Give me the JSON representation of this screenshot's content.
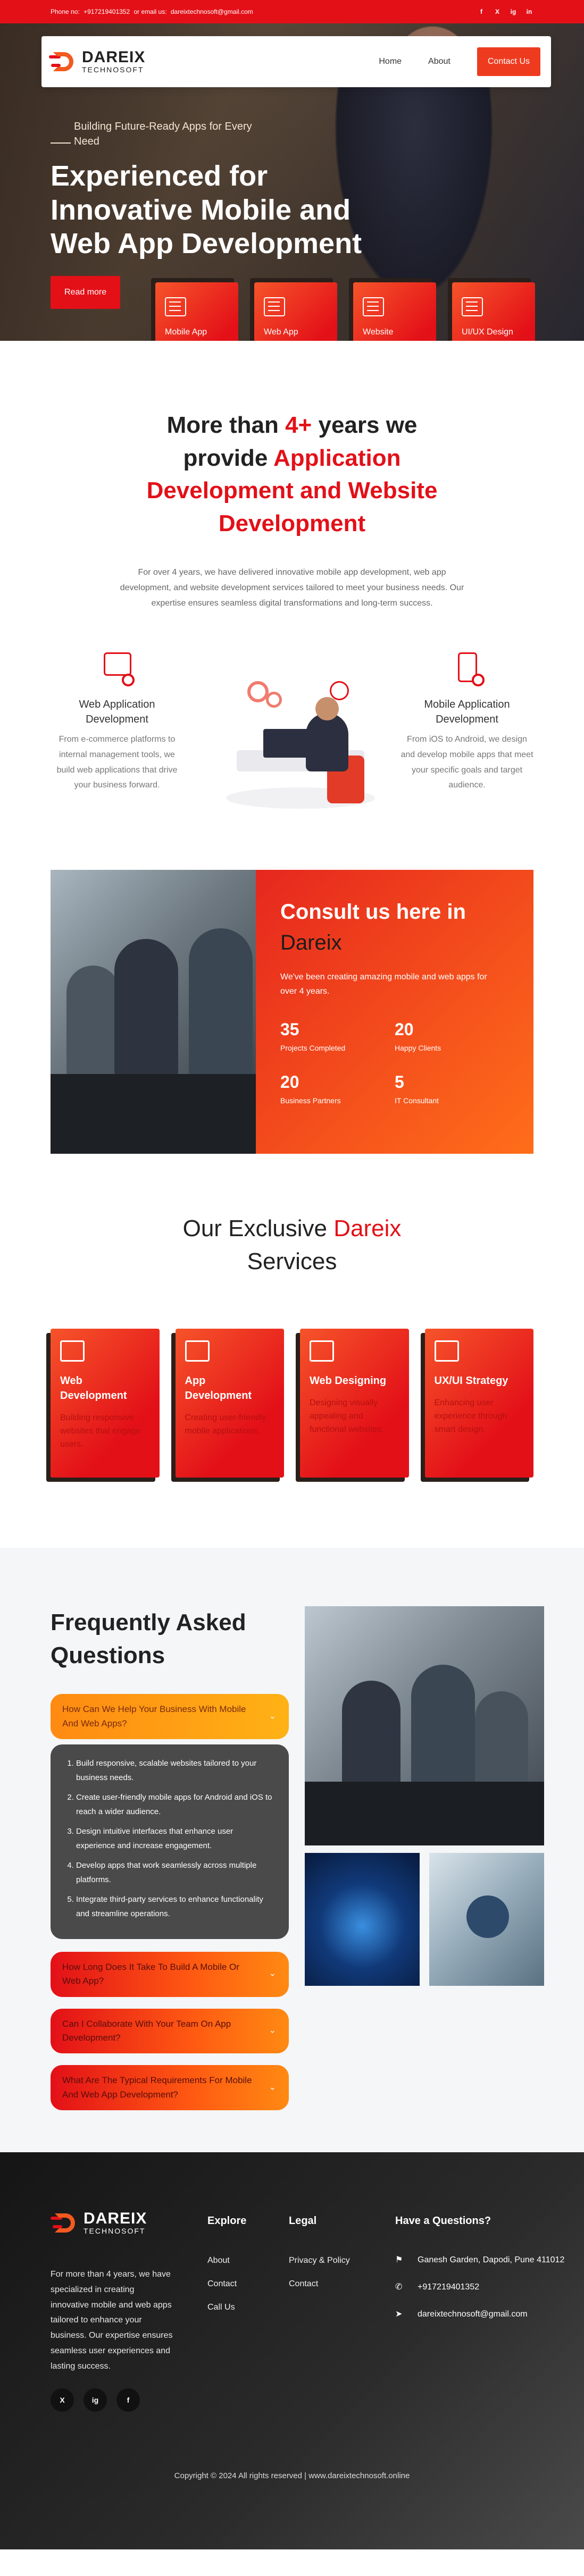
{
  "topbar": {
    "phone_label": "Phone no:",
    "phone": "+917219401352",
    "email_label": "or email us:",
    "email": "dareixtechnosoft@gmail.com",
    "socials": [
      "f",
      "X",
      "ig",
      "in"
    ]
  },
  "brand": {
    "name": "DAREIX",
    "sub": "TECHNOSOFT"
  },
  "nav": {
    "links": [
      "Home",
      "About"
    ],
    "cta": "Contact Us"
  },
  "hero": {
    "tagline": "Building Future-Ready Apps for Every Need",
    "title": "Experienced for Innovative Mobile and Web App Development",
    "button": "Read more",
    "cards": [
      "Mobile App Development",
      "Web App Development",
      "Website Development",
      "UI/UX Design"
    ]
  },
  "about": {
    "heading_1": "More than",
    "heading_highlight_1": "4+",
    "heading_2": "years we provide",
    "heading_highlight_2": "Application Development and Website Development",
    "lead": "For over 4 years, we have delivered innovative mobile app development, web app development, and website development services tailored to meet your business needs. Our expertise ensures seamless digital transformations and long-term success.",
    "features": [
      {
        "title": "Web Application Development",
        "text": "From e-commerce platforms to internal management tools, we build web applications that drive your business forward."
      },
      {
        "title": "Mobile Application Development",
        "text": "From iOS to Android, we design and develop mobile apps that meet your specific goals and target audience."
      }
    ]
  },
  "consult": {
    "title": "Consult us here in",
    "title_dark": "Dareix",
    "desc": "We've been creating amazing mobile and web apps for over 4 years.",
    "stats": [
      {
        "num": "35",
        "label": "Projects Completed"
      },
      {
        "num": "20",
        "label": "Happy Clients"
      },
      {
        "num": "20",
        "label": "Business Partners"
      },
      {
        "num": "5",
        "label": "IT Consultant"
      }
    ]
  },
  "services": {
    "heading_1": "Our Exclusive",
    "heading_highlight": "Dareix",
    "heading_2": "Services",
    "items": [
      {
        "title": "Web Development",
        "text": "Building responsive websites that engage users."
      },
      {
        "title": "App Development",
        "text": "Creating user-friendly mobile applications."
      },
      {
        "title": "Web Designing",
        "text": "Designing visually appealing and functional websites."
      },
      {
        "title": "UX/UI Strategy",
        "text": "Enhancing user experience through smart design."
      }
    ]
  },
  "faq": {
    "title": "Frequently Asked Questions",
    "open_question": "How Can We Help Your Business With Mobile And Web Apps?",
    "answers": [
      "Build responsive, scalable websites tailored to your business needs.",
      "Create user-friendly mobile apps for Android and iOS to reach a wider audience.",
      "Design intuitive interfaces that enhance user experience and increase engagement.",
      "Develop apps that work seamlessly across multiple platforms.",
      "Integrate third-party services to enhance functionality and streamline operations."
    ],
    "questions": [
      "How Long Does It Take To Build A Mobile Or Web App?",
      "Can I Collaborate With Your Team On App Development?",
      "What Are The Typical Requirements For Mobile And Web App Development?"
    ]
  },
  "footer": {
    "about": "For more than 4 years, we have specialized in creating innovative mobile and web apps tailored to enhance your business. Our expertise ensures seamless user experiences and lasting success.",
    "socials": [
      "X",
      "ig",
      "f"
    ],
    "explore_title": "Explore",
    "explore": [
      "About",
      "Contact",
      "Call Us"
    ],
    "legal_title": "Legal",
    "legal": [
      "Privacy & Policy",
      "Contact"
    ],
    "contact_title": "Have a Questions?",
    "address": "Ganesh Garden, Dapodi, Pune 411012",
    "phone": "+917219401352",
    "email": "dareixtechnosoft@gmail.com",
    "copyright": "Copyright © 2024 All rights reserved | www.dareixtechnosoft.online"
  }
}
